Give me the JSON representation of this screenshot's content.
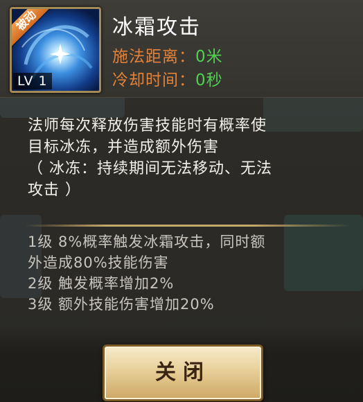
{
  "skill": {
    "tag": "被动",
    "level": "LV 1",
    "name": "冰霜攻击",
    "cast_range_label": "施法距离：",
    "cast_range_value": "0米",
    "cooldown_label": "冷却时间：",
    "cooldown_value": "0秒",
    "description_lines": [
      "法师每次释放伤害技能时有概率使",
      "目标冰冻，并造成额外伤害",
      "（ 冰冻：持续期间无法移动、无法",
      "攻击 ）"
    ],
    "level_effects": [
      "1级 8%概率触发冰霜攻击，同时额",
      "外造成80%技能伤害",
      "2级 触发概率增加2%",
      "3级 额外技能伤害增加20%"
    ]
  },
  "buttons": {
    "close": "关闭"
  },
  "colors": {
    "label_orange": "#e3823a",
    "value_green": "#4fd24f",
    "tag_orange": "#d36a20",
    "button_gold": "#e7cf98"
  },
  "icons": {
    "skill": "frost-orb-icon"
  }
}
